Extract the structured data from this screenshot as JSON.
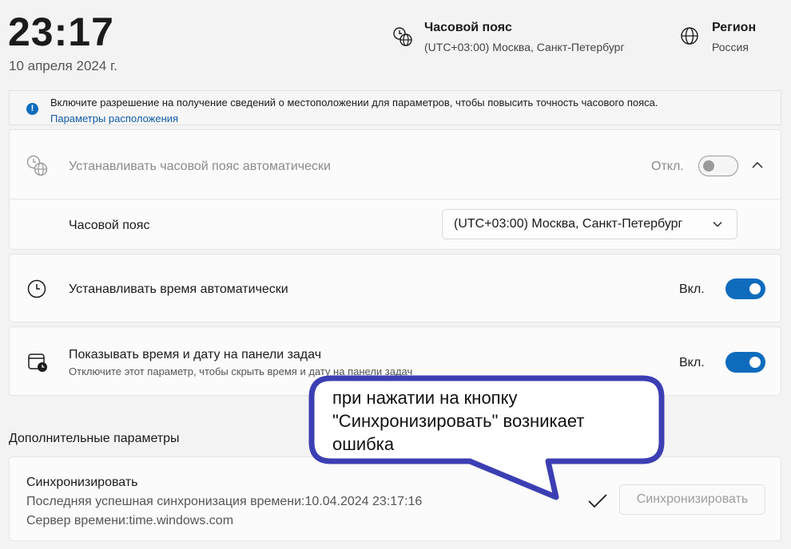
{
  "header": {
    "time": "23:17",
    "date": "10 апреля 2024 г.",
    "timezone_title": "Часовой пояс",
    "timezone_value": "(UTC+03:00) Москва, Санкт-Петербург",
    "region_title": "Регион",
    "region_value": "Россия"
  },
  "infobar": {
    "text": "Включите разрешение на получение сведений о местоположении для параметров, чтобы повысить точность часового пояса.",
    "link": "Параметры расположения"
  },
  "auto_timezone": {
    "label": "Устанавливать часовой пояс автоматически",
    "state": "Откл.",
    "enabled": false
  },
  "timezone_row": {
    "label": "Часовой пояс",
    "selected": "(UTC+03:00) Москва, Санкт-Петербург"
  },
  "auto_time": {
    "label": "Устанавливать время автоматически",
    "state": "Вкл.",
    "enabled": true
  },
  "taskbar_time": {
    "label": "Показывать время и дату на панели задач",
    "sub": "Отключите этот параметр, чтобы скрыть время и дату на панели задач",
    "state": "Вкл.",
    "enabled": true
  },
  "additional": {
    "title": "Дополнительные параметры"
  },
  "sync": {
    "title": "Синхронизировать",
    "last_sync": "Последняя успешная синхронизация времени:10.04.2024 23:17:16",
    "server": "Сервер времени:time.windows.com",
    "button": "Синхронизировать"
  },
  "annotation": {
    "lines": [
      "при нажатии на кнопку",
      "\"Синхронизировать\" возникает",
      "ошибка"
    ]
  },
  "colors": {
    "accent": "#0f6cbd",
    "annotation_border": "#3c3fb3",
    "background": "#f3f3f3"
  }
}
